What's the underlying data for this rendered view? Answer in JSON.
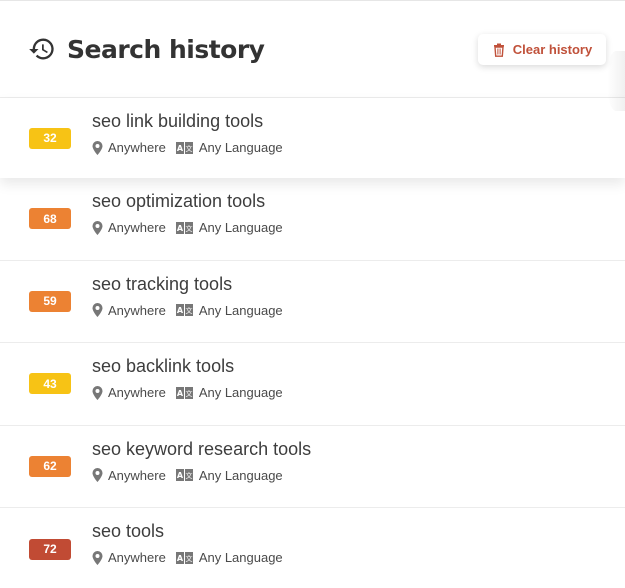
{
  "header": {
    "title": "Search history",
    "clear_label": "Clear history",
    "history_icon": "history-icon",
    "trash_icon": "trash-icon"
  },
  "colors": {
    "accent": "#c0513a",
    "badge_yellow": "#f7c315",
    "badge_orange": "#ec8233",
    "badge_red": "#c14b34"
  },
  "items": [
    {
      "keyword": "seo link building tools",
      "difficulty": "32",
      "location": "Anywhere",
      "language": "Any Language",
      "badge_color": "#f7c315"
    },
    {
      "keyword": "seo optimization tools",
      "difficulty": "68",
      "location": "Anywhere",
      "language": "Any Language",
      "badge_color": "#ec8233"
    },
    {
      "keyword": "seo tracking tools",
      "difficulty": "59",
      "location": "Anywhere",
      "language": "Any Language",
      "badge_color": "#ec8233"
    },
    {
      "keyword": "seo backlink tools",
      "difficulty": "43",
      "location": "Anywhere",
      "language": "Any Language",
      "badge_color": "#f7c315"
    },
    {
      "keyword": "seo keyword research tools",
      "difficulty": "62",
      "location": "Anywhere",
      "language": "Any Language",
      "badge_color": "#ec8233"
    },
    {
      "keyword": "seo tools",
      "difficulty": "72",
      "location": "Anywhere",
      "language": "Any Language",
      "badge_color": "#c14b34"
    }
  ]
}
